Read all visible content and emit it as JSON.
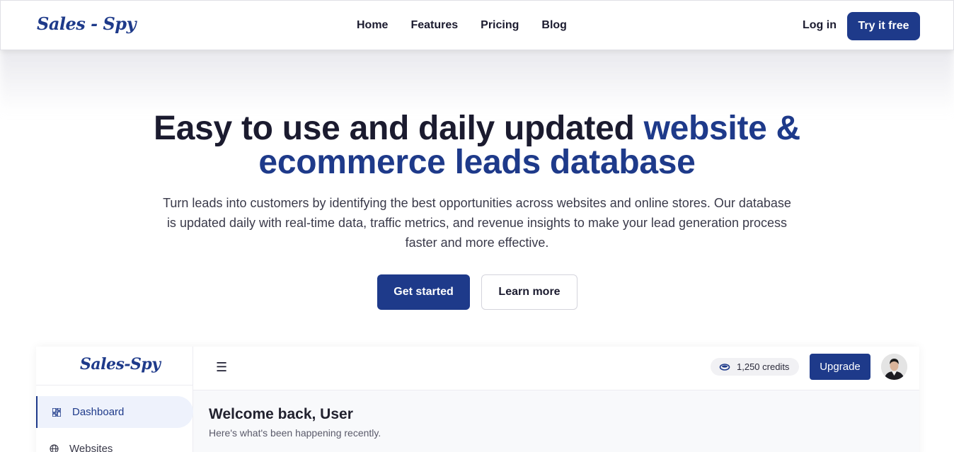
{
  "navbar": {
    "logo": "Sales - Spy",
    "links": [
      "Home",
      "Features",
      "Pricing",
      "Blog"
    ],
    "login_label": "Log in",
    "cta_label": "Try it free"
  },
  "hero": {
    "title_part1": "Easy to use and daily updated ",
    "title_accent": "website & ecommerce leads database",
    "subtitle": "Turn leads into customers by identifying the best opportunities across websites and online stores. Our database is updated daily with real-time data, traffic metrics, and revenue insights to make your lead generation process faster and more effective.",
    "primary_button": "Get started",
    "secondary_button": "Learn more"
  },
  "app_preview": {
    "logo": "Sales-Spy",
    "sidebar": {
      "items": [
        {
          "label": "Dashboard",
          "icon": "dashboard-icon",
          "active": true
        },
        {
          "label": "Websites",
          "icon": "globe-icon",
          "active": false
        }
      ]
    },
    "topbar": {
      "menu_icon": "☰",
      "credits": "1,250 credits",
      "upgrade_label": "Upgrade"
    },
    "main": {
      "welcome_title": "Welcome back, User",
      "welcome_subtitle": "Here's what's been happening recently."
    }
  },
  "colors": {
    "brand": "#1e3a8a",
    "text": "#1b1b2f"
  }
}
